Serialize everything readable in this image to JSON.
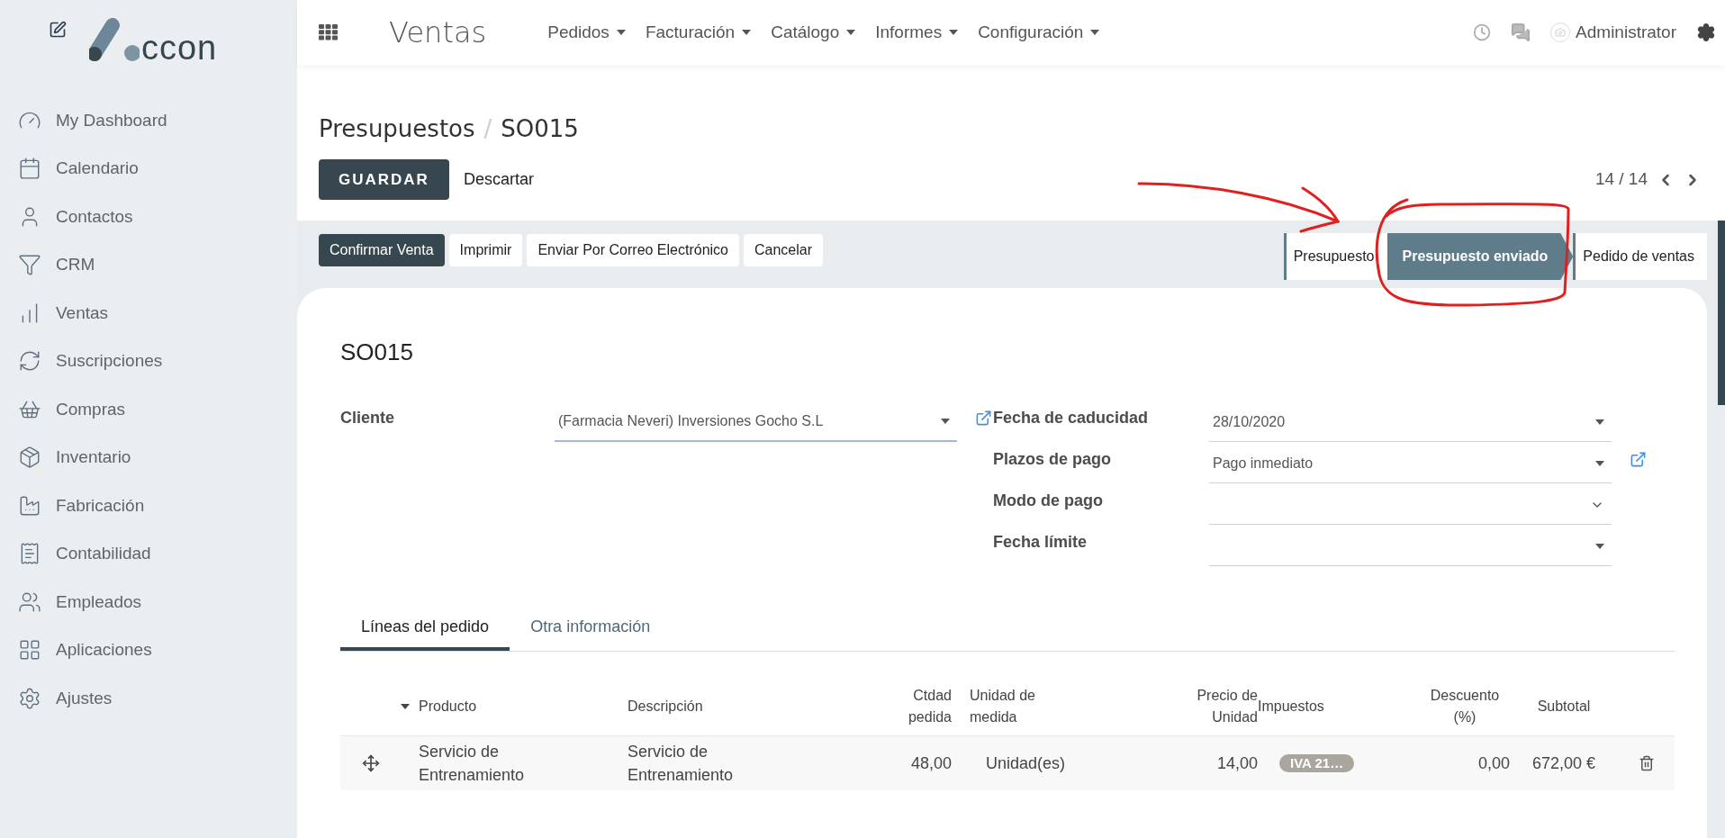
{
  "sidebar": {
    "logo_text": "ccon",
    "items": [
      {
        "label": "My Dashboard"
      },
      {
        "label": "Calendario"
      },
      {
        "label": "Contactos"
      },
      {
        "label": "CRM"
      },
      {
        "label": "Ventas"
      },
      {
        "label": "Suscripciones"
      },
      {
        "label": "Compras"
      },
      {
        "label": "Inventario"
      },
      {
        "label": "Fabricación"
      },
      {
        "label": "Contabilidad"
      },
      {
        "label": "Empleados"
      },
      {
        "label": "Aplicaciones"
      },
      {
        "label": "Ajustes"
      }
    ]
  },
  "topbar": {
    "app_title": "Ventas",
    "menus": [
      "Pedidos",
      "Facturación",
      "Catálogo",
      "Informes",
      "Configuración"
    ],
    "user": "Administrator"
  },
  "breadcrumb": {
    "parent": "Presupuestos",
    "separator": "/",
    "current": "SO015"
  },
  "actions": {
    "save": "GUARDAR",
    "discard": "Descartar"
  },
  "pager": "14 / 14",
  "buttons": [
    {
      "label": "Confirmar Venta",
      "kind": "primary"
    },
    {
      "label": "Imprimir",
      "kind": "secondary"
    },
    {
      "label": "Enviar Por Correo Electrónico",
      "kind": "secondary"
    },
    {
      "label": "Cancelar",
      "kind": "secondary"
    }
  ],
  "stages": [
    {
      "label": "Presupuesto",
      "selected": false
    },
    {
      "label": "Presupuesto enviado",
      "selected": true
    },
    {
      "label": "Pedido de ventas",
      "selected": false
    }
  ],
  "form": {
    "title": "SO015",
    "left": [
      {
        "label": "Cliente",
        "value": "(Farmacia Neveri) Inversiones Gocho S.L",
        "kind": "caret",
        "external_link": true,
        "focused": true
      }
    ],
    "right": [
      {
        "label": "Fecha de caducidad",
        "value": "28/10/2020",
        "kind": "caret",
        "external_link": false,
        "focused": false
      },
      {
        "label": "Plazos de pago",
        "value": "Pago inmediato",
        "kind": "caret",
        "external_link": true,
        "focused": false
      },
      {
        "label": "Modo de pago",
        "kind": "chevron",
        "external_link": false,
        "focused": false
      },
      {
        "label": "Fecha límite",
        "kind": "caret",
        "external_link": false,
        "focused": false
      }
    ]
  },
  "tabs": [
    {
      "label": "Líneas del pedido",
      "selected": true
    },
    {
      "label": "Otra información",
      "selected": false
    }
  ],
  "table": {
    "columns": [
      "Producto",
      "Descripción",
      "Ctdad pedida",
      "Unidad de medida",
      "Precio de Unidad",
      "Impuestos",
      "Descuento (%)",
      "Subtotal"
    ],
    "rows": [
      {
        "product": "Servicio de Entrenamiento",
        "description": "Servicio de Entrenamiento",
        "quantity": "48,00",
        "unit": "Unidad(es)",
        "price": "14,00",
        "tax": "IVA 21…",
        "discount": "0,00",
        "subtotal": "672,00 €"
      }
    ]
  }
}
